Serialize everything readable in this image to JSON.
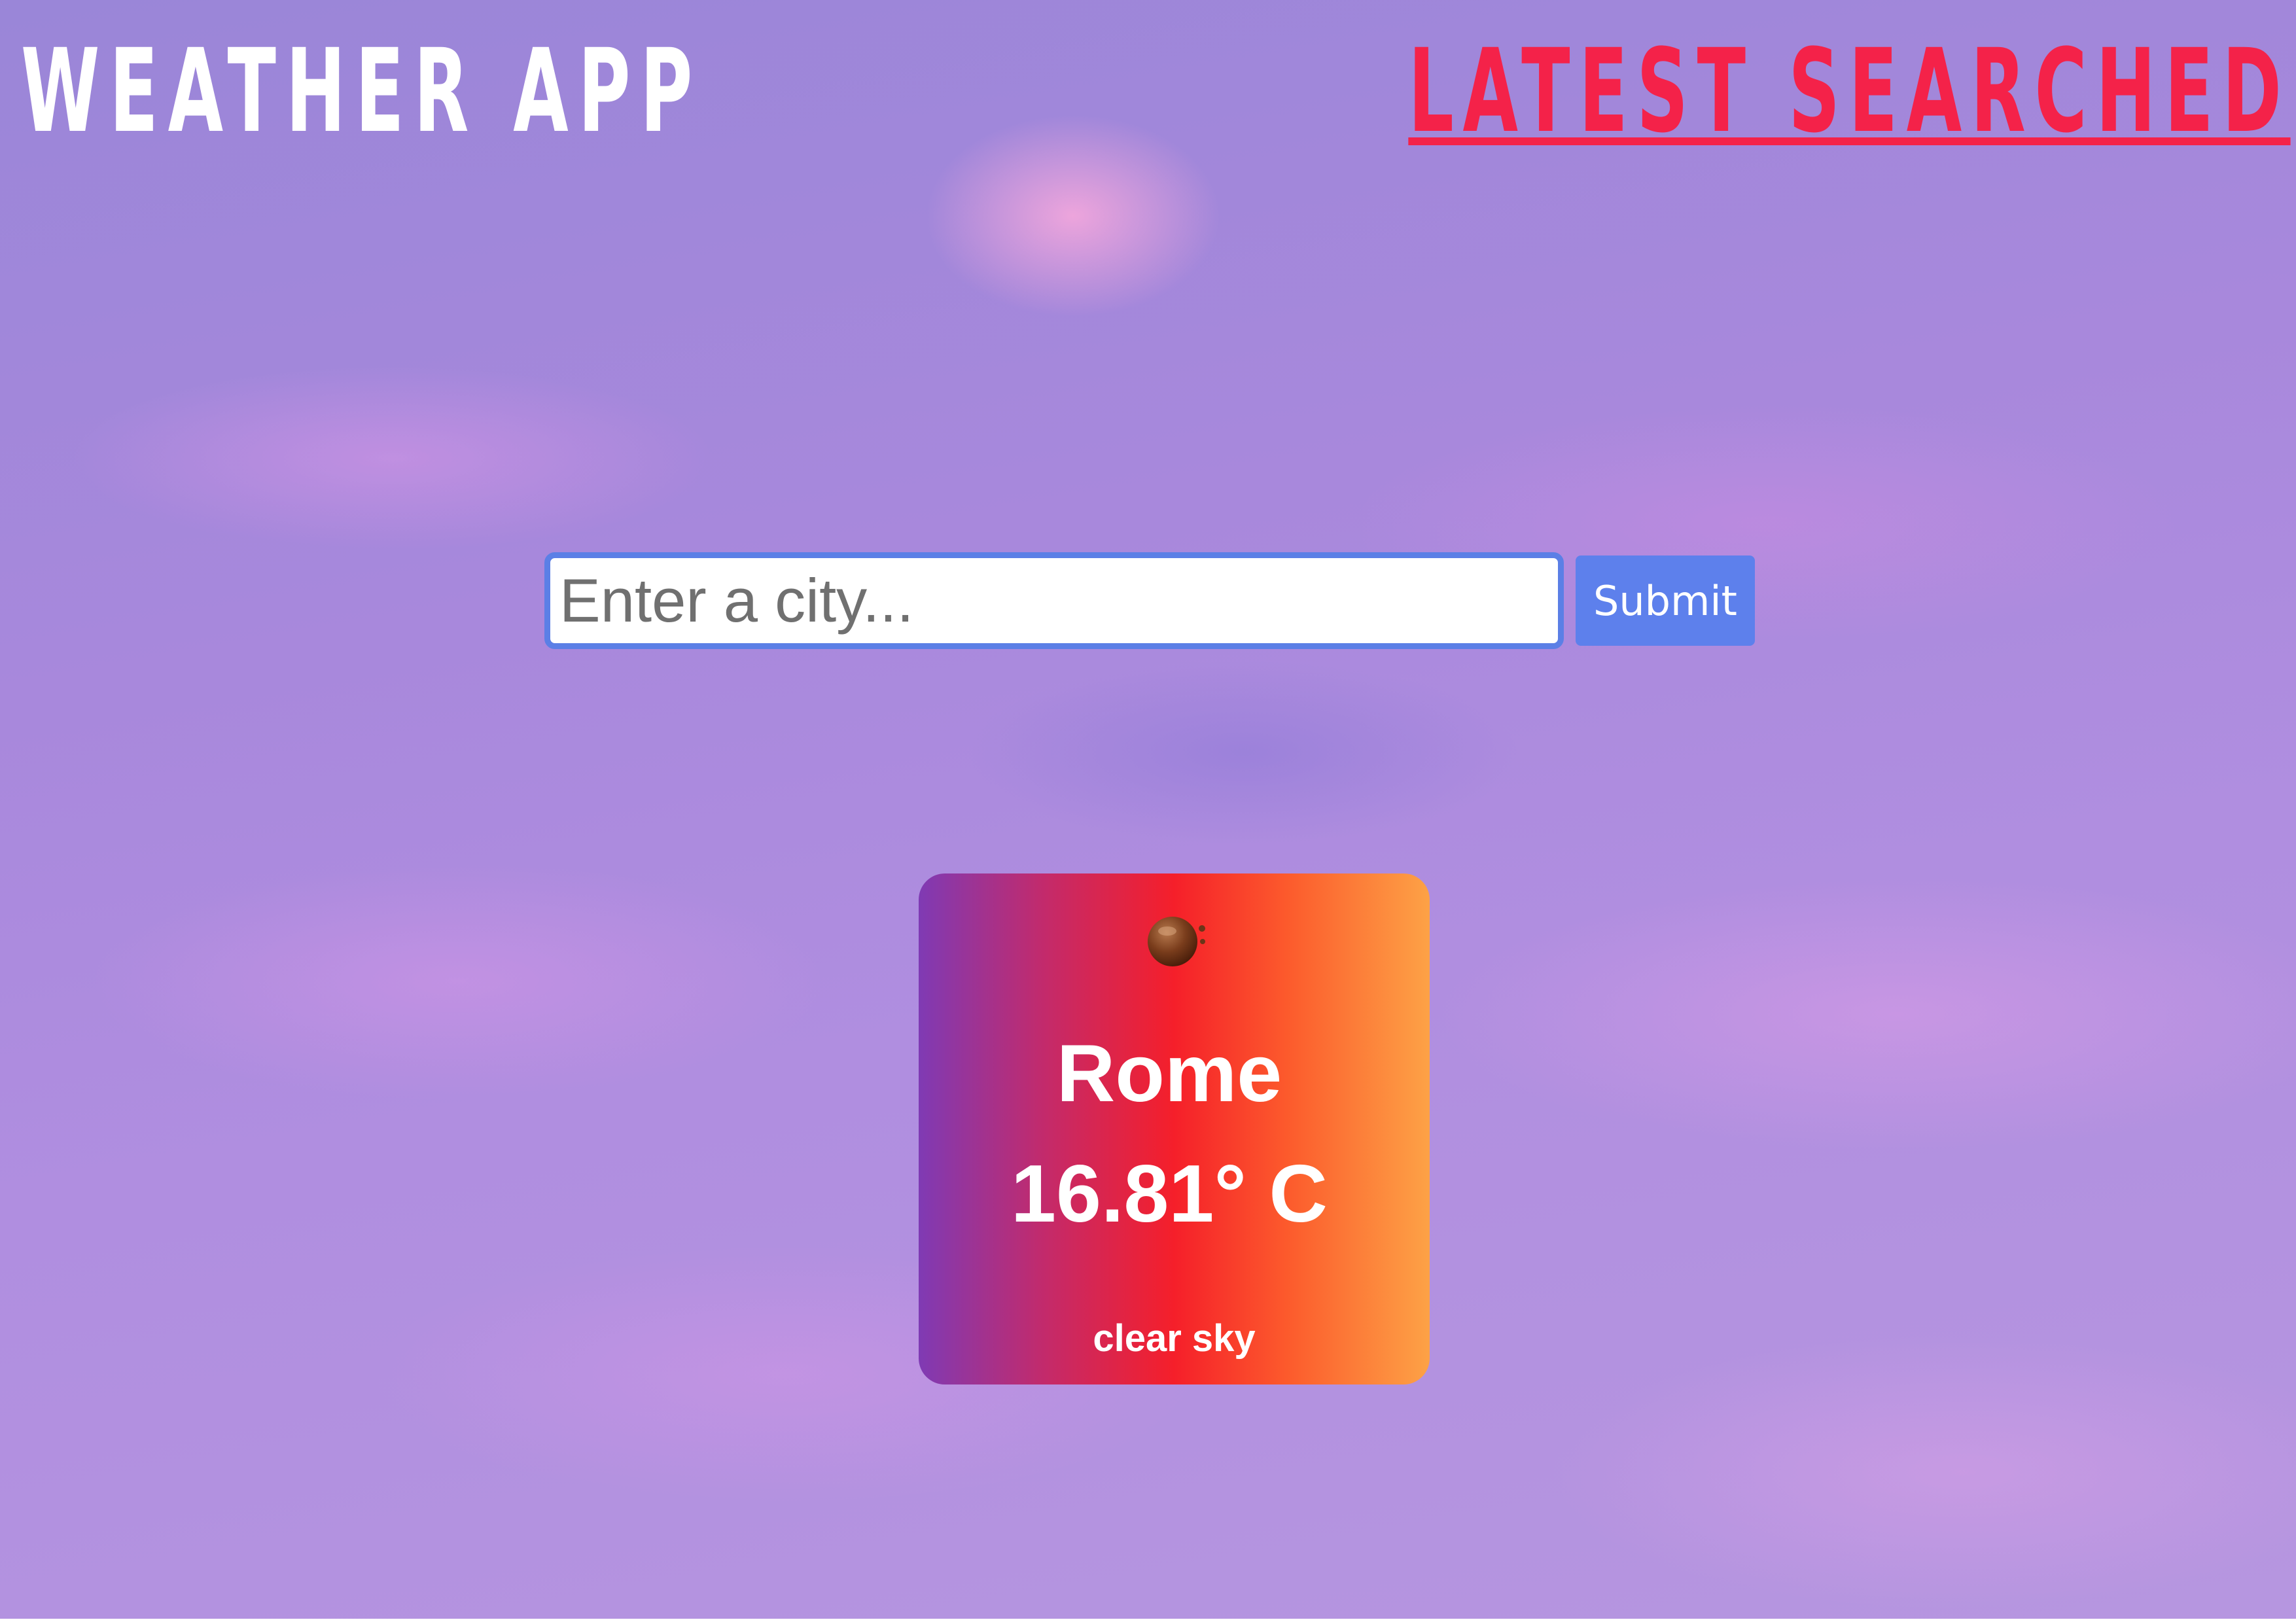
{
  "header": {
    "title": "WEATHER APP",
    "latest_searched_label": "LATEST SEARCHED"
  },
  "search": {
    "placeholder": "Enter a city...",
    "value": "",
    "submit_label": "Submit"
  },
  "weather": {
    "icon": "dark-moon-icon",
    "city": "Rome",
    "temperature": "16.81° C",
    "description": "clear sky"
  },
  "colors": {
    "title": "#ffffff",
    "latest_searched": "#f42249",
    "input_border": "#5b7fe6",
    "submit_button": "#5d80ec",
    "card_gradient": [
      "#7f3ab4",
      "#f51f2a",
      "#fda246"
    ]
  }
}
